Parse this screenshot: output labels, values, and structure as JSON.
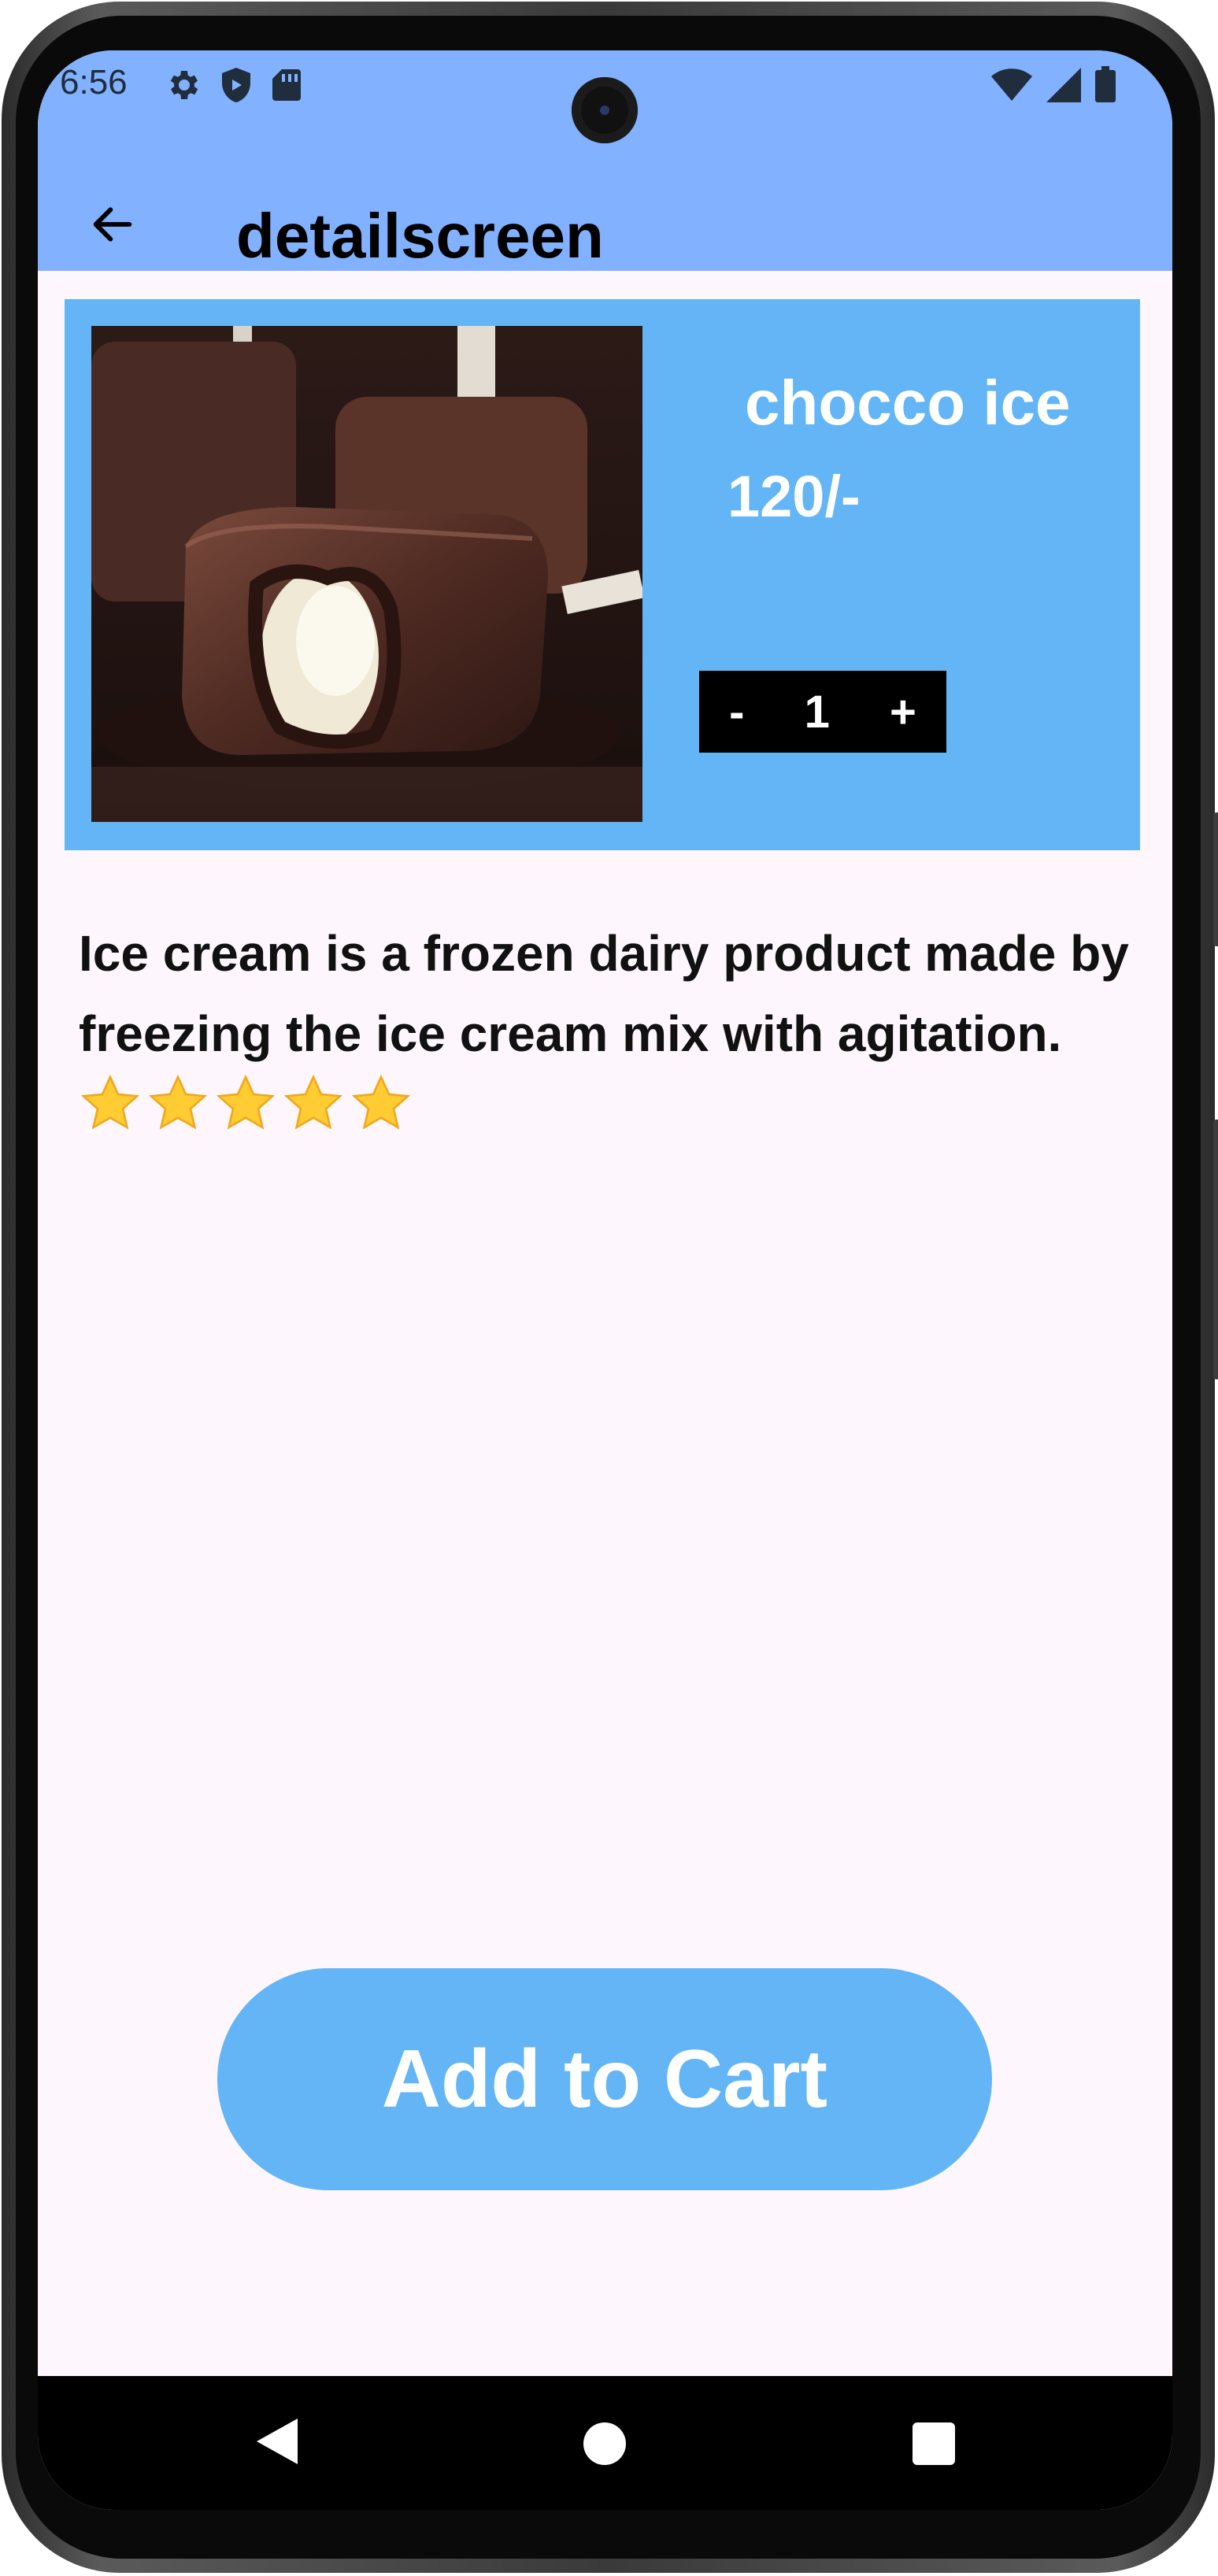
{
  "status_bar": {
    "time": "6:56",
    "left_icons": [
      "gear-icon",
      "shield-icon",
      "sd-card-icon"
    ],
    "right_icons": [
      "wifi-icon",
      "signal-icon",
      "battery-icon"
    ]
  },
  "app_bar": {
    "title": "detailscreen",
    "background": "#82b1ff"
  },
  "product": {
    "name": "chocco ice",
    "price": "120/-",
    "quantity": {
      "decrement": "-",
      "value": "1",
      "increment": "+"
    },
    "card_color": "#64b5f6",
    "description": "Ice cream is a frozen dairy product made by freezing the ice cream mix with agitation.",
    "rating": 5
  },
  "actions": {
    "add_to_cart": "Add to Cart",
    "button_color": "#64b5f6"
  },
  "nav_bar": [
    "back-triangle-icon",
    "home-circle-icon",
    "recents-square-icon"
  ]
}
